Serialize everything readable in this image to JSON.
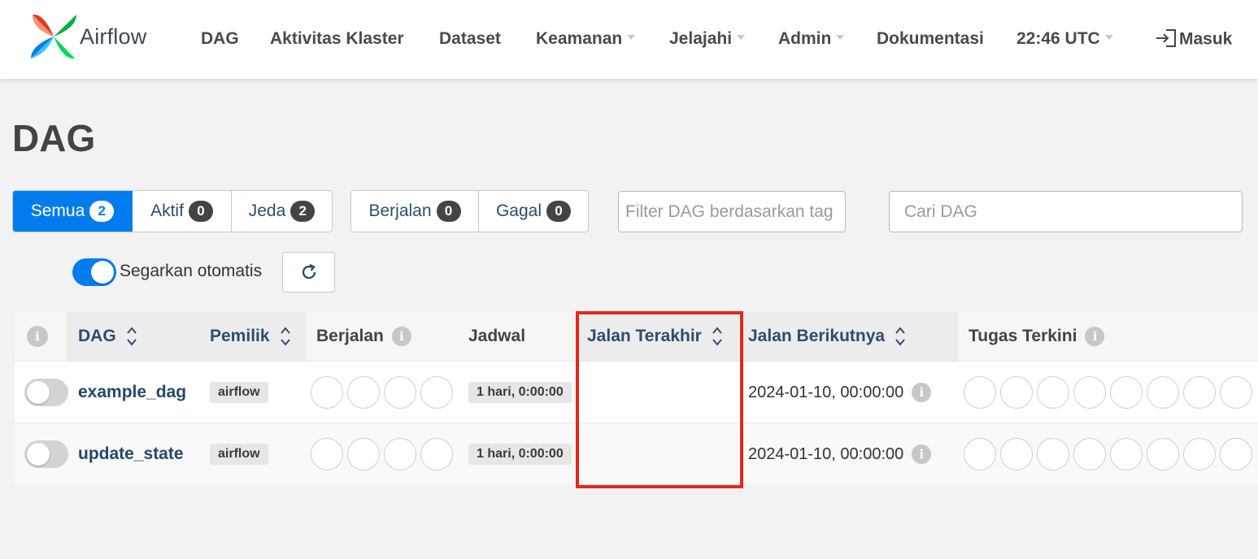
{
  "brand": {
    "name": "Airflow"
  },
  "nav": {
    "items": [
      {
        "label": "DAG",
        "dropdown": false
      },
      {
        "label": "Aktivitas Klaster",
        "dropdown": false
      },
      {
        "label": "Dataset",
        "dropdown": false
      },
      {
        "label": "Keamanan",
        "dropdown": true
      },
      {
        "label": "Jelajahi",
        "dropdown": true
      },
      {
        "label": "Admin",
        "dropdown": true
      },
      {
        "label": "Dokumentasi",
        "dropdown": false
      }
    ],
    "time": "22:46 UTC",
    "login": "Masuk"
  },
  "page": {
    "title": "DAG"
  },
  "filters": {
    "status": [
      {
        "label": "Semua",
        "count": "2",
        "active": true
      },
      {
        "label": "Aktif",
        "count": "0",
        "active": false
      },
      {
        "label": "Jeda",
        "count": "2",
        "active": false
      }
    ],
    "run_state": [
      {
        "label": "Berjalan",
        "count": "0"
      },
      {
        "label": "Gagal",
        "count": "0"
      }
    ],
    "tag_filter_placeholder": "Filter DAG berdasarkan tag",
    "search_placeholder": "Cari DAG"
  },
  "auto_refresh": {
    "label": "Segarkan otomatis",
    "enabled": true
  },
  "table": {
    "columns": {
      "dag": "DAG",
      "owner": "Pemilik",
      "runs": "Berjalan",
      "schedule": "Jadwal",
      "last_run": "Jalan Terakhir",
      "next_run": "Jalan Berikutnya",
      "recent_tasks": "Tugas Terkini"
    },
    "rows": [
      {
        "dag_id": "example_dag",
        "owner": "airflow",
        "schedule": "1 hari, 0:00:00",
        "last_run": "",
        "next_run": "2024-01-10, 00:00:00",
        "paused": true
      },
      {
        "dag_id": "update_state",
        "owner": "airflow",
        "schedule": "1 hari, 0:00:00",
        "last_run": "",
        "next_run": "2024-01-10, 00:00:00",
        "paused": true
      }
    ]
  },
  "colors": {
    "accent": "#017cee",
    "link": "#24486e",
    "highlight": "#e3281d"
  }
}
